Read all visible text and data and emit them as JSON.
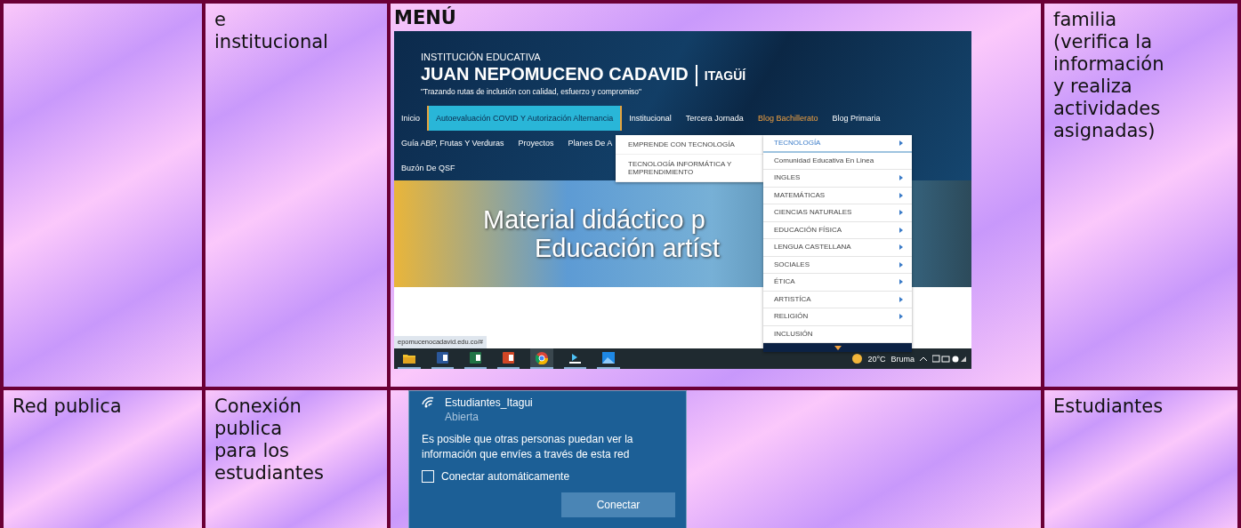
{
  "table": {
    "rows": [
      {
        "column_2": "e\ninstitucional",
        "column_3": {
          "heading": "MENÚ",
          "screenshot": {
            "kicker": "INSTITUCIÓN EDUCATIVA",
            "title": "JUAN NEPOMUCENO CADAVID",
            "title_suffix": "ITAGÜÍ",
            "tagline": "\"Trazando rutas de inclusión con calidad, esfuerzo y compromiso\"",
            "nav_rows": [
              [
                {
                  "label": "Inicio",
                  "selected": false,
                  "open": false
                },
                {
                  "label": "Autoevaluación COVID Y Autorización Alternancia",
                  "selected": true,
                  "open": false
                },
                {
                  "label": "Institucional",
                  "selected": false,
                  "open": false
                },
                {
                  "label": "Tercera Jornada",
                  "selected": false,
                  "open": false
                },
                {
                  "label": "Blog Bachillerato",
                  "selected": false,
                  "open": true
                },
                {
                  "label": "Blog Primaria",
                  "selected": false,
                  "open": false
                }
              ],
              [
                {
                  "label": "Guía ABP, Frutas Y Verduras",
                  "selected": false,
                  "open": false
                },
                {
                  "label": "Proyectos",
                  "selected": false,
                  "open": false
                },
                {
                  "label": "Planes De A",
                  "selected": false,
                  "open": false
                }
              ],
              [
                {
                  "label": "Buzón De QSF",
                  "selected": false,
                  "open": false
                }
              ]
            ],
            "banner_lines": [
              "Material didáctico p",
              "Educación artíst"
            ],
            "submenu": [
              "EMPRENDE CON TECNOLOGÍA",
              "TECNOLOGÍA INFORMÁTICA Y EMPRENDIMIENTO"
            ],
            "dropdown": [
              {
                "label": "TECNOLOGÍA",
                "selected": true,
                "has_submenu": true
              },
              {
                "label": "Comunidad Educativa En Linea",
                "selected": false,
                "has_submenu": false
              },
              {
                "label": "INGLES",
                "selected": false,
                "has_submenu": true
              },
              {
                "label": "MATEMÁTICAS",
                "selected": false,
                "has_submenu": true
              },
              {
                "label": "CIENCIAS NATURALES",
                "selected": false,
                "has_submenu": true
              },
              {
                "label": "EDUCACIÓN FÍSICA",
                "selected": false,
                "has_submenu": true
              },
              {
                "label": "LENGUA CASTELLANA",
                "selected": false,
                "has_submenu": true
              },
              {
                "label": "SOCIALES",
                "selected": false,
                "has_submenu": true
              },
              {
                "label": "ÉTICA",
                "selected": false,
                "has_submenu": true
              },
              {
                "label": "ARTISTÍCA",
                "selected": false,
                "has_submenu": true
              },
              {
                "label": "RELIGIÓN",
                "selected": false,
                "has_submenu": true
              },
              {
                "label": "INCLUSIÓN",
                "selected": false,
                "has_submenu": false
              }
            ],
            "status_url": "epomucenocadavid.edu.co/#",
            "taskbar": {
              "apps": [
                {
                  "kind": "folder",
                  "selected": false
                },
                {
                  "kind": "word",
                  "selected": false
                },
                {
                  "kind": "excel",
                  "selected": false
                },
                {
                  "kind": "powerpoint",
                  "selected": false
                },
                {
                  "kind": "browser",
                  "selected": true
                },
                {
                  "kind": "app",
                  "selected": false
                },
                {
                  "kind": "photos",
                  "selected": false
                }
              ],
              "temperature": "20°C",
              "weather": "Bruma"
            }
          }
        },
        "column_4": "familia\n(verifica la\ninformación\ny realiza\nactividades\nasignadas)"
      },
      {
        "column_1": "Red publica",
        "column_2": "Conexión\npublica\npara los\nestudiantes",
        "column_3": {
          "wifi_dialog": {
            "network": "Estudiantes_Itagui",
            "status": "Abierta",
            "message": "Es posible que otras personas puedan ver la información que envíes a través de esta red",
            "auto_connect": {
              "label": "Conectar automáticamente",
              "checked": false
            },
            "button": "Conectar"
          }
        },
        "column_4": "Estudiantes"
      }
    ]
  }
}
